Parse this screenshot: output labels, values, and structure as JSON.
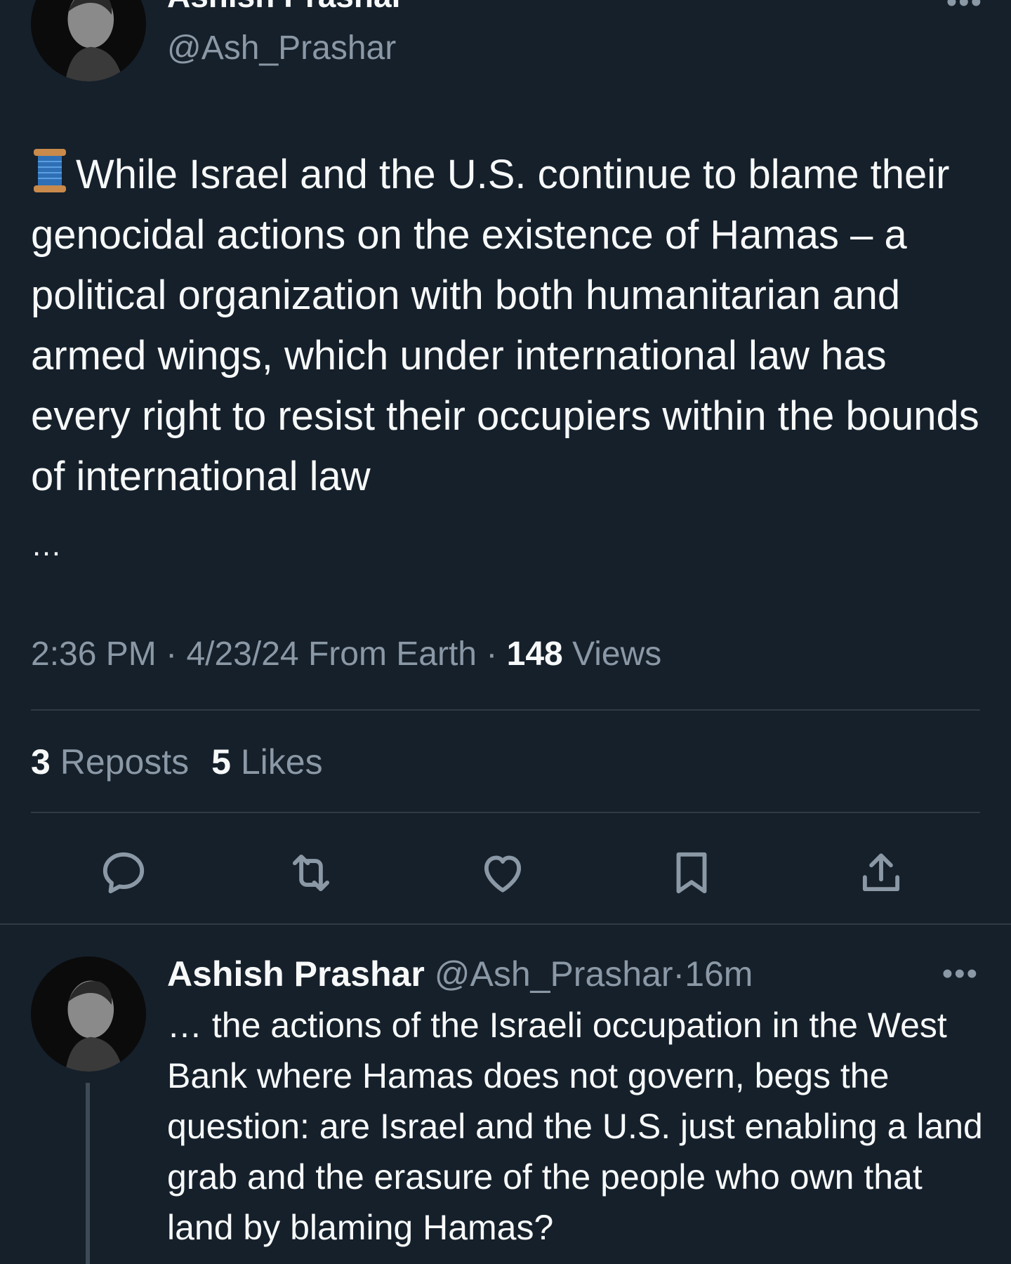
{
  "main_tweet": {
    "author_name": "Ashish Prashar",
    "author_handle": "@Ash_Prashar",
    "thread_icon": "spool-of-thread-emoji",
    "text": "While Israel and the U.S. continue to blame their genocidal actions on the existence of Hamas – a political organization with both humanitarian and armed wings, which under international law has every right to resist their occupiers within the bounds of international law",
    "continuation": "…",
    "time": "2:36 PM",
    "date": "4/23/24",
    "source": "From Earth",
    "views_count": "148",
    "views_label": "Views",
    "reposts_count": "3",
    "reposts_label": "Reposts",
    "likes_count": "5",
    "likes_label": "Likes",
    "more_label": "•••"
  },
  "actions": [
    {
      "name": "reply",
      "icon": "reply-icon"
    },
    {
      "name": "repost",
      "icon": "repost-icon"
    },
    {
      "name": "like",
      "icon": "heart-icon"
    },
    {
      "name": "bookmark",
      "icon": "bookmark-icon"
    },
    {
      "name": "share",
      "icon": "share-icon"
    }
  ],
  "reply_tweet": {
    "author_name": "Ashish Prashar",
    "author_handle": "@Ash_Prashar",
    "separator": "·",
    "time_ago": "16m",
    "more_label": "•••",
    "text": "… the actions of the Israeli occupation in the West Bank where Hamas does not govern, begs the question: are Israel and the U.S. just enabling a land grab and the erasure of the people who own that land by blaming Hamas?"
  },
  "colors": {
    "background": "#15202b",
    "primary_text": "#f7f9f9",
    "secondary_text": "#8b98a5",
    "divider": "#2f3a45"
  }
}
